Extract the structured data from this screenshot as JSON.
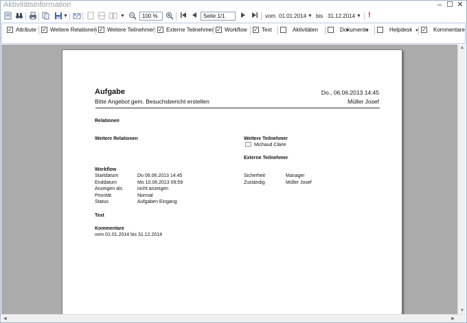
{
  "window": {
    "title": "Aktivitätsinformation",
    "minimize": "–",
    "maximize": "☐",
    "close": "✕"
  },
  "toolbar": {
    "zoom_value": "100 %",
    "page_value": "Seite 1/1",
    "from_label": "vom",
    "from_date": "01.01.2014",
    "to_label": "bis",
    "to_date": "31.12.2014",
    "alert_icon": "!"
  },
  "filters": [
    {
      "label": "Attribute",
      "checked": true
    },
    {
      "label": "Weitere Relationen",
      "checked": true
    },
    {
      "label": "Weitere Teilnehmer",
      "checked": true
    },
    {
      "label": "Externe Teilnehmer",
      "checked": true
    },
    {
      "label": "Workflow",
      "checked": true
    },
    {
      "label": "Text",
      "checked": true
    },
    {
      "label": "Aktivitäten",
      "checked": false
    },
    {
      "label": "Dokumente",
      "checked": false
    },
    {
      "label": "Helpdesk",
      "checked": false
    },
    {
      "label": "Kommentare",
      "checked": true
    }
  ],
  "document": {
    "heading": "Aufgabe",
    "date": "Do., 06.06.2013 14:45",
    "subject": "Bitte Angebot gem. Besuchsbericht erstellen",
    "owner": "Müller Josef",
    "relationen": "Relationen",
    "weitere_relationen": "Weitere Relationen",
    "weitere_teilnehmer": "Weitere Teilnehmer",
    "teilnehmer_name": "Michaud Claire",
    "externe_teilnehmer": "Externe Teilnehmer",
    "workflow": "Workflow",
    "workflow_rows": [
      {
        "label": "Startdatum",
        "value": "Do 06.06.2013 14:45"
      },
      {
        "label": "Enddatum",
        "value": "Mo 10.06.2013 09:59"
      },
      {
        "label": "Anzeigen als",
        "value": "nicht anzeigen"
      },
      {
        "label": "Priorität",
        "value": "Normal"
      },
      {
        "label": "Status",
        "value": "Aufgaben Eingang"
      }
    ],
    "workflow_right": [
      {
        "label": "Sicherheit",
        "value": "Manager"
      },
      {
        "label": "Zuständig",
        "value": "Müller Josef"
      }
    ],
    "text": "Text",
    "kommentare": "Kommentare",
    "kommentare_range": "vom 01.01.2014 bis 31.12.2014"
  }
}
